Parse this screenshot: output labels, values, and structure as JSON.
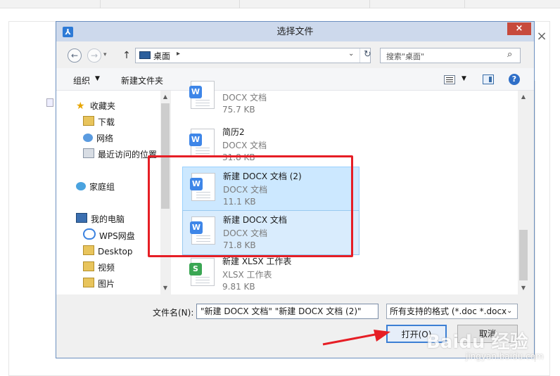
{
  "dialog": {
    "title": "选择文件",
    "close_glyph": "×",
    "logo_glyph": "⅄"
  },
  "background": {
    "close_glyph": "×"
  },
  "nav_buttons": {
    "back_glyph": "←",
    "forward_glyph": "→",
    "up_glyph": "↑"
  },
  "address": {
    "location": "桌面",
    "chevron": "▸",
    "dropdown": "⌄",
    "refresh_glyph": "↻"
  },
  "search": {
    "placeholder": "搜索\"桌面\"",
    "icon_glyph": "⌕"
  },
  "toolbar": {
    "organize_label": "组织",
    "organize_arrow": "▼",
    "new_folder_label": "新建文件夹",
    "view_arrow": "▼",
    "help_glyph": "?"
  },
  "nav_pane": {
    "star_glyph": "★",
    "favorites": "收藏夹",
    "downloads": "下载",
    "network": "网络",
    "recent": "最近访问的位置",
    "homegroup": "家庭组",
    "computer": "我的电脑",
    "wps_cloud": "WPS网盘",
    "desktop": "Desktop",
    "videos": "视频",
    "pictures": "图片",
    "arrow_up": "▲",
    "arrow_down": "▼"
  },
  "files": [
    {
      "name": "",
      "type": "DOCX 文档",
      "size": "75.7 KB",
      "badge": "W"
    },
    {
      "name": "简历2",
      "type": "DOCX 文档",
      "size": "31.8 KB",
      "badge": "W"
    },
    {
      "name": "新建 DOCX 文档 (2)",
      "type": "DOCX 文档",
      "size": "11.1 KB",
      "badge": "W"
    },
    {
      "name": "新建 DOCX 文档",
      "type": "DOCX 文档",
      "size": "71.8 KB",
      "badge": "W"
    },
    {
      "name": "新建 XLSX 工作表",
      "type": "XLSX 工作表",
      "size": "9.81 KB",
      "badge": "S"
    }
  ],
  "list_scroll": {
    "arrow_up": "▲",
    "arrow_down": "▼"
  },
  "bottom": {
    "filename_label": "文件名(N):",
    "filename_value": "\"新建 DOCX 文档\" \"新建 DOCX 文档 (2)\"",
    "filetype_value": "所有支持的格式 (*.doc *.docx",
    "filetype_arrow": "⌄",
    "open_label": "打开(O)",
    "cancel_label": "取消"
  },
  "watermark": {
    "brand": "Baidu 经验",
    "url": "jingyan.baidu.com"
  },
  "colors": {
    "highlight_red": "#e61e25",
    "selection_blue": "#cce8ff",
    "title_bar": "#cdd9ec",
    "close_red": "#c74a3c"
  }
}
